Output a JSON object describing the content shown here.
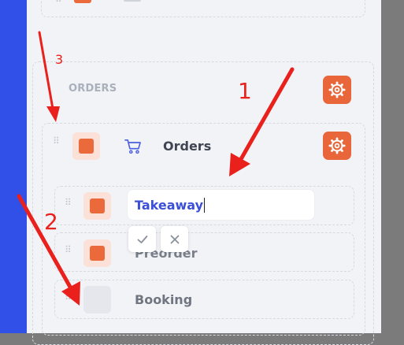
{
  "section": {
    "title": "ORDERS"
  },
  "items": {
    "orders": {
      "label": "Orders"
    },
    "takeaway": {
      "value": "Takeaway"
    },
    "preorder": {
      "label": "Preorder"
    },
    "booking": {
      "label": "Booking"
    }
  },
  "annotations": {
    "one": "1",
    "two": "2",
    "three": "3"
  },
  "icons": {
    "gear": "gear-icon",
    "cart": "cart-icon",
    "confirm": "check-icon",
    "cancel": "close-icon",
    "drag": "drag-handle-icon"
  },
  "colors": {
    "accent": "#e8663a",
    "input_text": "#3b4fd8",
    "annotation": "#e9201b",
    "sidebar_blue": "#3150e8"
  }
}
